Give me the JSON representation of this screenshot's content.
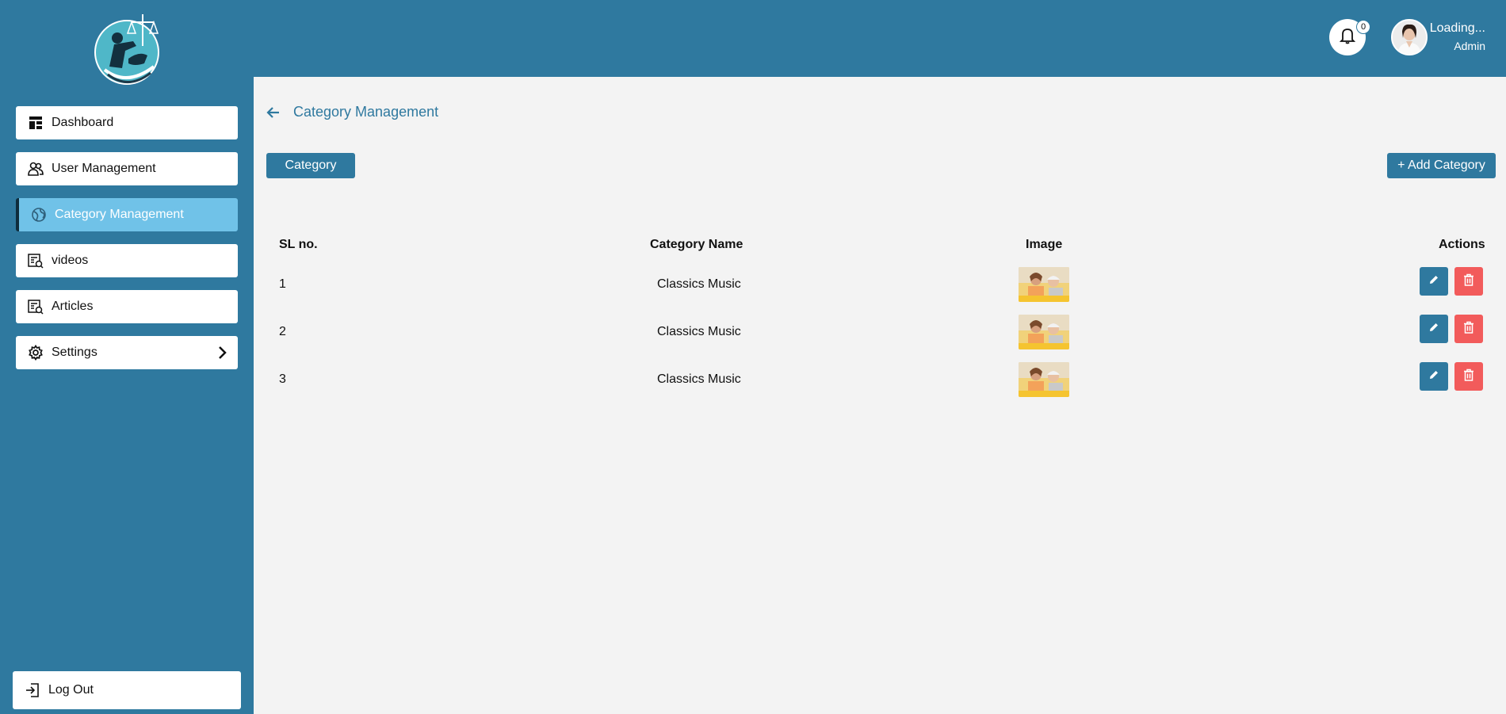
{
  "sidebar": {
    "items": [
      {
        "label": "Dashboard",
        "icon": "dashboard-icon"
      },
      {
        "label": "User Management",
        "icon": "users-icon"
      },
      {
        "label": "Category Management",
        "icon": "category-icon",
        "active": true
      },
      {
        "label": "videos",
        "icon": "videos-icon"
      },
      {
        "label": "Articles",
        "icon": "articles-icon"
      },
      {
        "label": "Settings",
        "icon": "gear-icon"
      }
    ],
    "logout_label": "Log Out"
  },
  "topbar": {
    "notification_count": "0",
    "user_name": "Loading...",
    "user_role": "Admin"
  },
  "page": {
    "title": "Category Management",
    "category_button": "Category",
    "add_button": "+ Add Category"
  },
  "table": {
    "headers": [
      "SL no.",
      "Category Name",
      "Image",
      "Actions"
    ],
    "rows": [
      {
        "sl": "1",
        "name": "Classics Music"
      },
      {
        "sl": "2",
        "name": "Classics Music"
      },
      {
        "sl": "3",
        "name": "Classics Music"
      }
    ]
  },
  "colors": {
    "primary": "#2f799f",
    "active_nav": "#70c2e8",
    "delete": "#f25b5b",
    "background": "#f3f3f3"
  }
}
